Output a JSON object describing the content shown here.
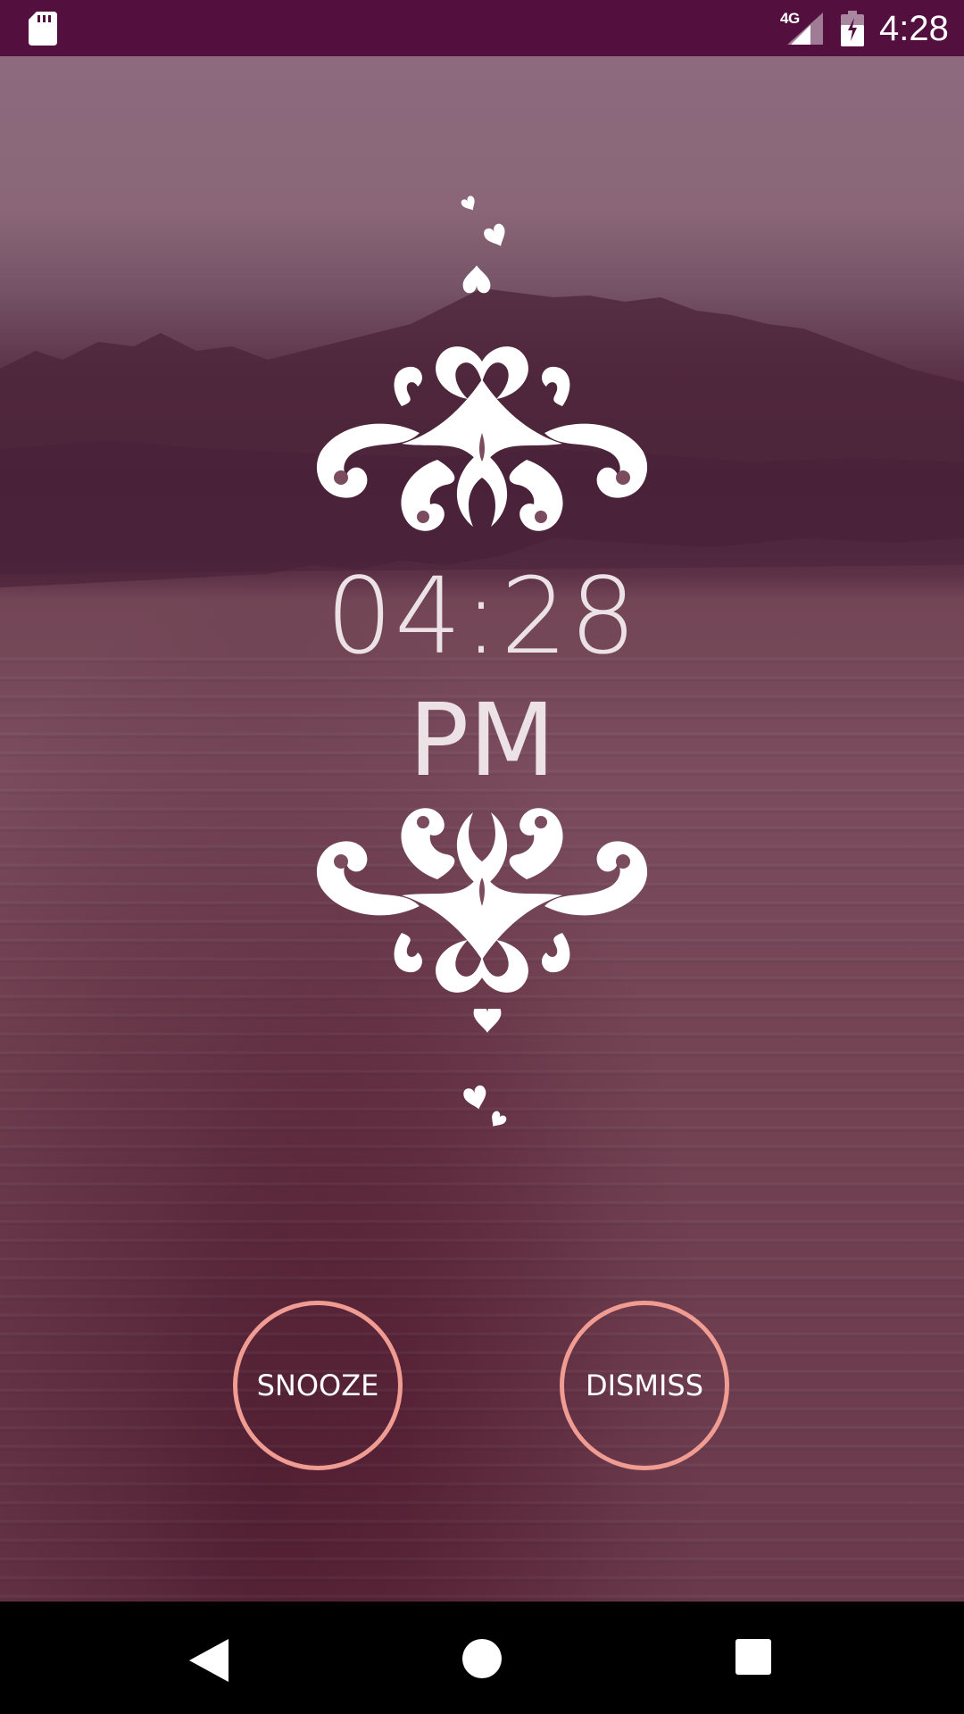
{
  "status_bar": {
    "time": "4:28",
    "network": "4G",
    "background_color": "#530f3e",
    "icons": [
      "sd-card-icon",
      "signal-icon",
      "battery-charging-icon"
    ]
  },
  "alarm": {
    "time": "04:28",
    "ampm": "PM"
  },
  "buttons": {
    "snooze_label": "SNOOZE",
    "dismiss_label": "DISMISS",
    "ring_color": "#f19c92"
  },
  "nav_bar": {
    "icons": [
      "back-icon",
      "home-icon",
      "recents-icon"
    ]
  },
  "colors": {
    "text": "#ece2e6",
    "wallpaper_tint": "#7a4c5e"
  }
}
